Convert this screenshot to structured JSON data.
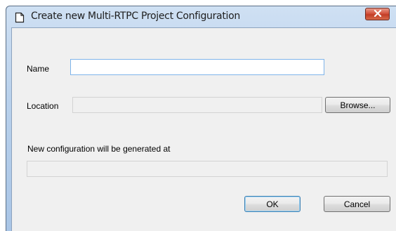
{
  "window": {
    "title": "Create new Multi-RTPC Project Configuration"
  },
  "form": {
    "name_label": "Name",
    "name_value": "",
    "location_label": "Location",
    "location_value": "",
    "browse_label": "Browse...",
    "generated_label": "New configuration will be generated at",
    "generated_value": ""
  },
  "buttons": {
    "ok_label": "OK",
    "cancel_label": "Cancel"
  },
  "colors": {
    "close_button": "#c23d26",
    "titlebar": "#b9d1ec",
    "client_background": "#f0f0f0"
  }
}
